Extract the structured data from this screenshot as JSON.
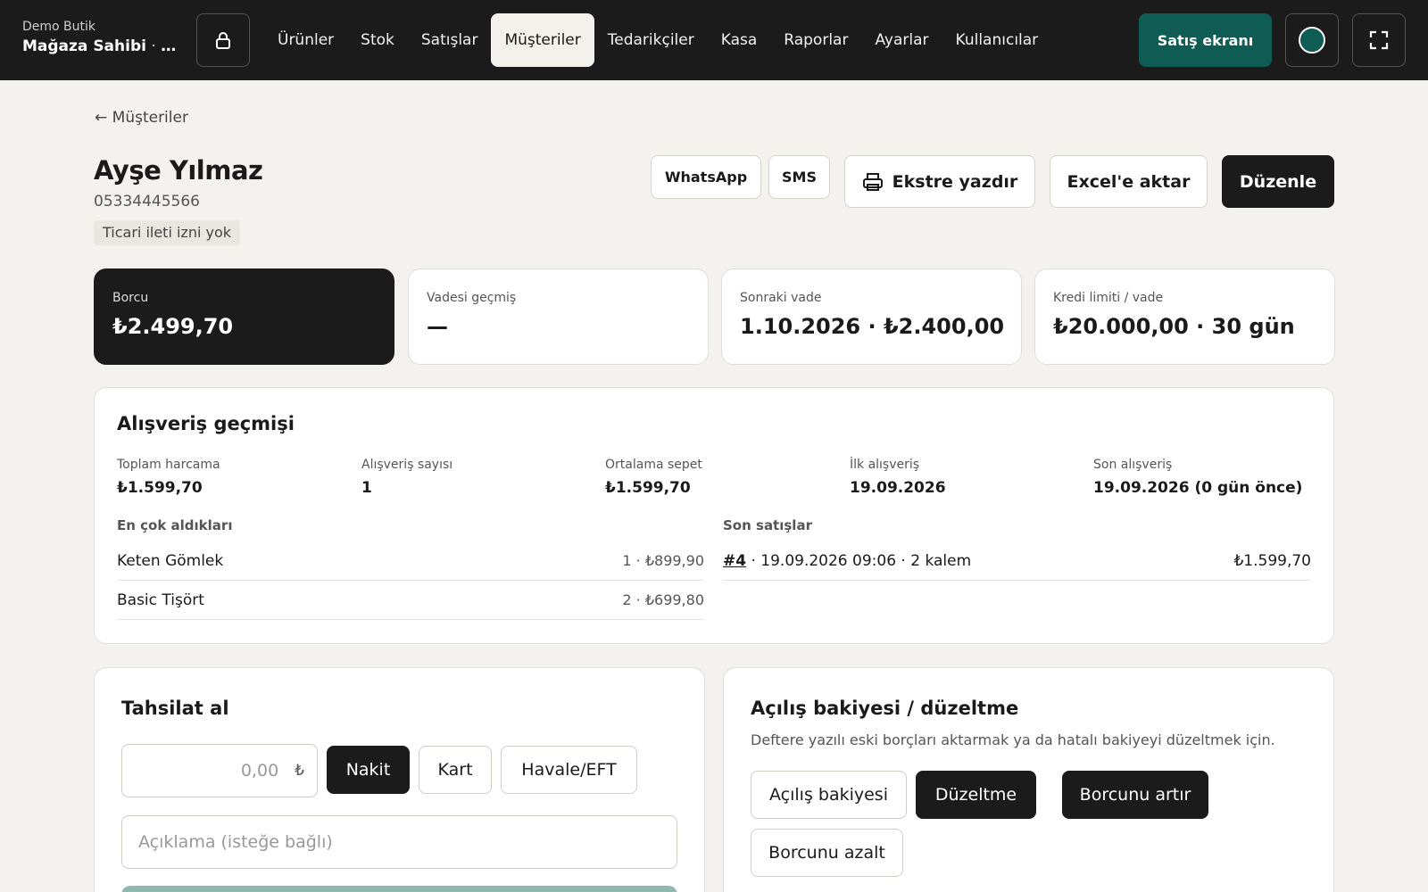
{
  "topbar": {
    "store_name": "Demo Butik",
    "user_name": "Mağaza Sahibi",
    "user_role": " · S...",
    "nav": [
      "Ürünler",
      "Stok",
      "Satışlar",
      "Müşteriler",
      "Tedarikçiler",
      "Kasa",
      "Raporlar",
      "Ayarlar",
      "Kullanıcılar"
    ],
    "active_nav": "Müşteriler",
    "pos_button": "Satış ekranı",
    "accent_color": "#0e5c53"
  },
  "header": {
    "back_link": "← Müşteriler",
    "customer_name": "Ayşe Yılmaz",
    "phone": "05334445566",
    "consent_badge": "Ticari ileti izni yok",
    "actions": {
      "whatsapp": "WhatsApp",
      "sms": "SMS",
      "print_statement": "Ekstre yazdır",
      "export_excel": "Excel'e aktar",
      "edit": "Düzenle"
    }
  },
  "stats": [
    {
      "label": "Borcu",
      "value": "₺2.499,70"
    },
    {
      "label": "Vadesi geçmiş",
      "value": "—"
    },
    {
      "label": "Sonraki vade",
      "value": "1.10.2026 · ₺2.400,00"
    },
    {
      "label": "Kredi limiti / vade",
      "value": "₺20.000,00 · 30 gün"
    }
  ],
  "history": {
    "title": "Alışveriş geçmişi",
    "summary": [
      {
        "label": "Toplam harcama",
        "value": "₺1.599,70"
      },
      {
        "label": "Alışveriş sayısı",
        "value": "1"
      },
      {
        "label": "Ortalama sepet",
        "value": "₺1.599,70"
      },
      {
        "label": "İlk alışveriş",
        "value": "19.09.2026"
      },
      {
        "label": "Son alışveriş",
        "value": "19.09.2026 (0 gün önce)"
      }
    ],
    "top_items_title": "En çok aldıkları",
    "top_items": [
      {
        "name": "Keten Gömlek",
        "detail": "1 · ₺899,90"
      },
      {
        "name": "Basic Tişört",
        "detail": "2 · ₺699,80"
      }
    ],
    "recent_sales_title": "Son satışlar",
    "recent_sales": [
      {
        "no": "#4",
        "detail": " · 19.09.2026 09:06 · 2 kalem",
        "total": "₺1.599,70"
      }
    ]
  },
  "collection": {
    "title": "Tahsilat al",
    "amount_placeholder": "0,00",
    "currency": "₺",
    "methods": [
      "Nakit",
      "Kart",
      "Havale/EFT"
    ],
    "selected_method": "Nakit",
    "note_placeholder": "Açıklama (isteğe bağlı)"
  },
  "adjustment": {
    "title": "Açılış bakiyesi / düzeltme",
    "description": "Deftere yazılı eski borçları aktarmak ya da hatalı bakiyeyi düzeltmek için.",
    "modes": [
      "Açılış bakiyesi",
      "Düzeltme"
    ],
    "selected_mode": "Düzeltme",
    "directions": [
      "Borcunu artır",
      "Borcunu azalt"
    ],
    "selected_direction": "Borcunu artır"
  }
}
